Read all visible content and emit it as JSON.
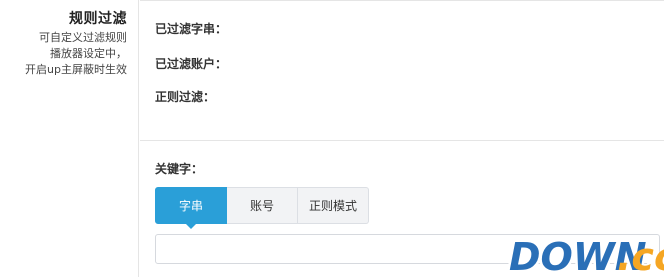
{
  "sidebar": {
    "title": "规则过滤",
    "description": [
      "可自定义过滤规则",
      "播放器设定中，",
      "开启up主屏蔽时生效"
    ]
  },
  "filters": {
    "filtered_strings_label": "已过滤字串：",
    "filtered_accounts_label": "已过滤账户：",
    "regex_filter_label": "正则过滤："
  },
  "keyword": {
    "label": "关键字：",
    "tabs": [
      {
        "label": "字串",
        "active": true
      },
      {
        "label": "账号",
        "active": false
      },
      {
        "label": "正则模式",
        "active": false
      }
    ],
    "input_value": "",
    "input_placeholder": ""
  },
  "watermark": {
    "text": "DOWN.cc",
    "colors": {
      "primary": "#2a6fb7",
      "accent": "#f5a623"
    }
  },
  "colors": {
    "accent": "#2a9fd8",
    "tab_bg": "#f2f3f5",
    "border": "#e5e5e5"
  }
}
